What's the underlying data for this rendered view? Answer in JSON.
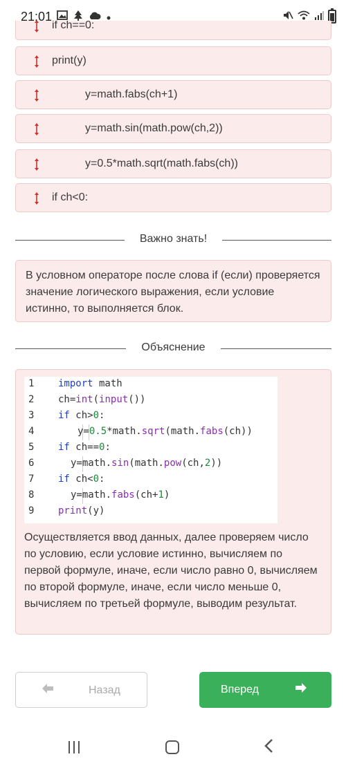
{
  "status_bar": {
    "time": "21:01",
    "left_icons": [
      "image-icon",
      "tree-icon",
      "cloud-icon",
      "dot-icon"
    ],
    "right_icons": [
      "mute-icon",
      "wifi-icon",
      "signal-icon",
      "battery-icon"
    ]
  },
  "sortable": {
    "cut_item": "if ch==0:",
    "items": [
      {
        "label": "print(y)",
        "indent": 0
      },
      {
        "label": "y=math.fabs(ch+1)",
        "indent": 1
      },
      {
        "label": "y=math.sin(math.pow(ch,2))",
        "indent": 1
      },
      {
        "label": "y=0.5*math.sqrt(math.fabs(ch))",
        "indent": 1
      },
      {
        "label": "if ch<0:",
        "indent": 0
      }
    ],
    "handle_color": "#d0312d"
  },
  "important": {
    "heading": "Важно знать!",
    "text": "В условном операторе после слова if (если) проверяется значение логического выражения, если условие истинно, то выполняется блок."
  },
  "explanation": {
    "heading": "Объяснение",
    "code_lines": [
      {
        "n": "1",
        "code": "import math"
      },
      {
        "n": "2",
        "code": "ch=int(input())"
      },
      {
        "n": "3",
        "code": "if ch>0:"
      },
      {
        "n": "4",
        "code": "y=0.5*math.sqrt(math.fabs(ch))"
      },
      {
        "n": "5",
        "code": "if ch==0:"
      },
      {
        "n": "6",
        "code": "y=math.sin(math.pow(ch,2))"
      },
      {
        "n": "7",
        "code": "if ch<0:"
      },
      {
        "n": "8",
        "code": "y=math.fabs(ch+1)"
      },
      {
        "n": "9",
        "code": "print(y)"
      }
    ],
    "text": "Осуществляется ввод данных, далее проверяем число по условию, если условие истинно, вычисляем по первой формуле, иначе, если число равно 0, вычисляем по второй формуле, иначе, если число меньше 0, вычисляем по третьей формуле, выводим результат."
  },
  "nav_buttons": {
    "back_label": "Назад",
    "next_label": "Вперед",
    "next_color": "#3ab05a"
  },
  "android_nav": [
    "recent-apps-icon",
    "home-icon",
    "back-icon"
  ]
}
